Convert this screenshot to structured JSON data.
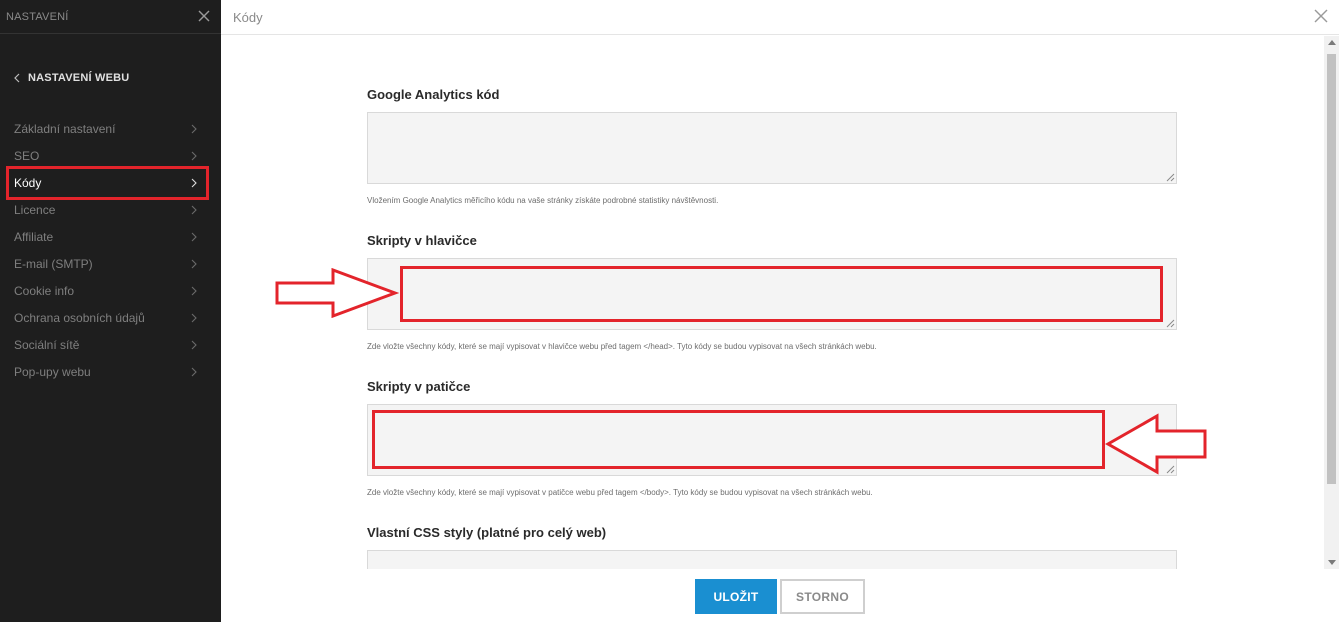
{
  "sidebar": {
    "title": "NASTAVENÍ",
    "back_label": "NASTAVENÍ WEBU",
    "items": [
      {
        "label": "Základní nastavení"
      },
      {
        "label": "SEO"
      },
      {
        "label": "Kódy"
      },
      {
        "label": "Licence"
      },
      {
        "label": "Affiliate"
      },
      {
        "label": "E-mail (SMTP)"
      },
      {
        "label": "Cookie info"
      },
      {
        "label": "Ochrana osobních údajů"
      },
      {
        "label": "Sociální sítě"
      },
      {
        "label": "Pop-upy webu"
      }
    ],
    "active_item": "Kódy"
  },
  "main": {
    "title": "Kódy",
    "fields": [
      {
        "label": "Google Analytics kód",
        "value": "",
        "hint": "Vložením Google Analytics měřicího kódu na vaše stránky získáte podrobné statistiky návštěvnosti."
      },
      {
        "label": "Skripty v hlavičce",
        "value": "",
        "hint": "Zde vložte všechny kódy, které se mají vypisovat v hlavičce webu před tagem </head>. Tyto kódy se budou vypisovat na všech stránkách webu."
      },
      {
        "label": "Skripty v patičce",
        "value": "",
        "hint": "Zde vložte všechny kódy, které se mají vypisovat v patičce webu před tagem </body>. Tyto kódy se budou vypisovat na všech stránkách webu."
      },
      {
        "label": "Vlastní CSS styly (platné pro celý web)",
        "value": ""
      }
    ]
  },
  "footer": {
    "save_label": "ULOŽIT",
    "cancel_label": "STORNO"
  },
  "colors": {
    "sidebar_bg": "#1e1e1e",
    "accent_blue": "#1a8fd1",
    "annotation_red": "#e3242b"
  },
  "icons": [
    "close-icon",
    "chevron-left-icon",
    "chevron-right-icon",
    "arrow-right-annotation",
    "arrow-left-annotation"
  ]
}
